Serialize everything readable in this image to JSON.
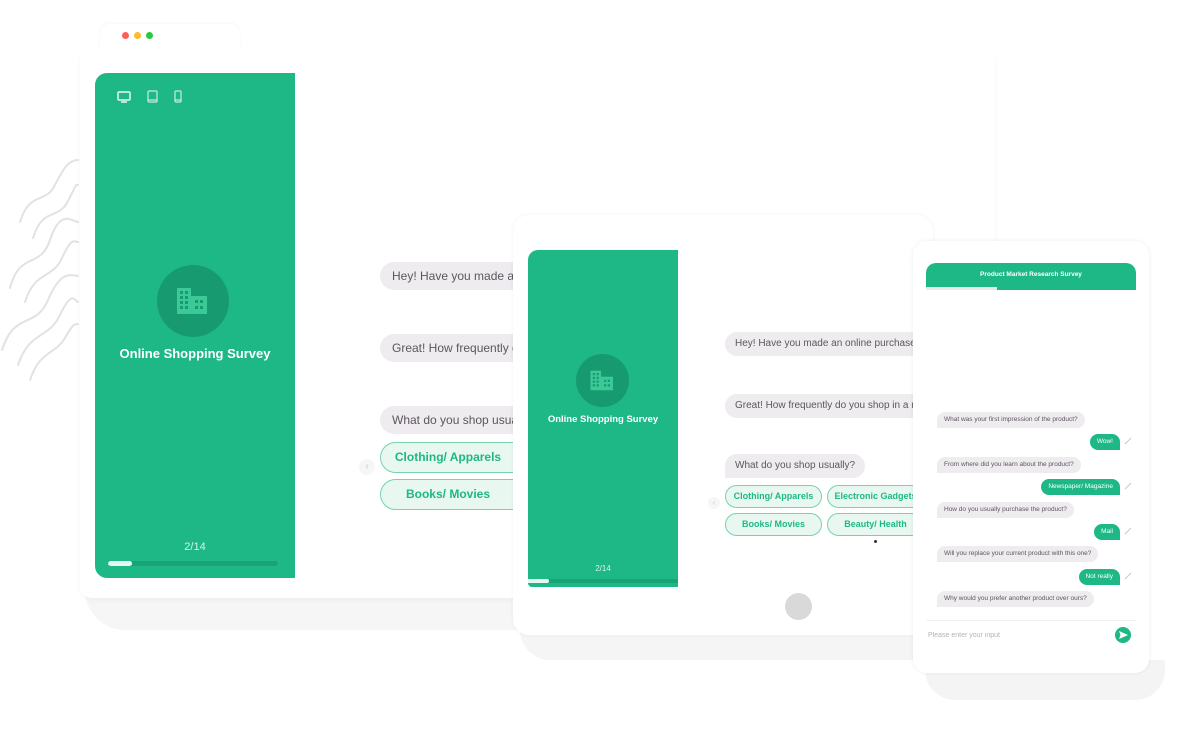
{
  "window_controls": {
    "close_color": "#fc5f57",
    "minimize_color": "#fdbc2e",
    "maximize_color": "#28c840"
  },
  "colors": {
    "brand_green": "#1db885",
    "brand_green_dark": "#179a6f",
    "bubble_bg": "#eeecee",
    "bubble_text": "#5e5560"
  },
  "desktop": {
    "device_icons": [
      "desktop-icon",
      "tablet-icon",
      "mobile-icon"
    ],
    "survey_icon": "building-icon",
    "survey_title": "Online Shopping Survey",
    "page_counter": "2/14",
    "progress_fraction": 0.143,
    "messages": [
      "Hey! Have you made an",
      "Great! How frequently do",
      "What do you shop usuall"
    ],
    "options": [
      "Clothing/ Apparels",
      "Books/ Movies"
    ],
    "prev_icon": "chevron-left-icon"
  },
  "tablet": {
    "survey_icon": "building-icon",
    "survey_title": "Online Shopping Survey",
    "page_counter": "2/14",
    "progress_fraction": 0.143,
    "messages": [
      "Hey! Have you made an online purchase b",
      "Great! How frequently do you shop in a mo",
      "What do you shop usually?"
    ],
    "options": [
      "Clothing/ Apparels",
      "Electronic Gadgets",
      "Books/ Movies",
      "Beauty/ Health"
    ],
    "prev_icon": "chevron-left-icon"
  },
  "phone": {
    "header_title": "Product Market Research Survey",
    "progress_fraction": 0.34,
    "conversation": [
      {
        "q": "What was your first impression of the product?",
        "a": "Wow!"
      },
      {
        "q": "From where did you learn about the product?",
        "a": "Newspaper/ Magazine"
      },
      {
        "q": "How do you usually purchase the product?",
        "a": "Mail"
      },
      {
        "q": "Will you replace your current product with this one?",
        "a": "Not really"
      },
      {
        "q": "Why would you prefer another product over ours?",
        "a": null
      }
    ],
    "input_placeholder": "Please enter your input",
    "send_icon": "send-icon",
    "edit_icon": "pencil-icon"
  }
}
